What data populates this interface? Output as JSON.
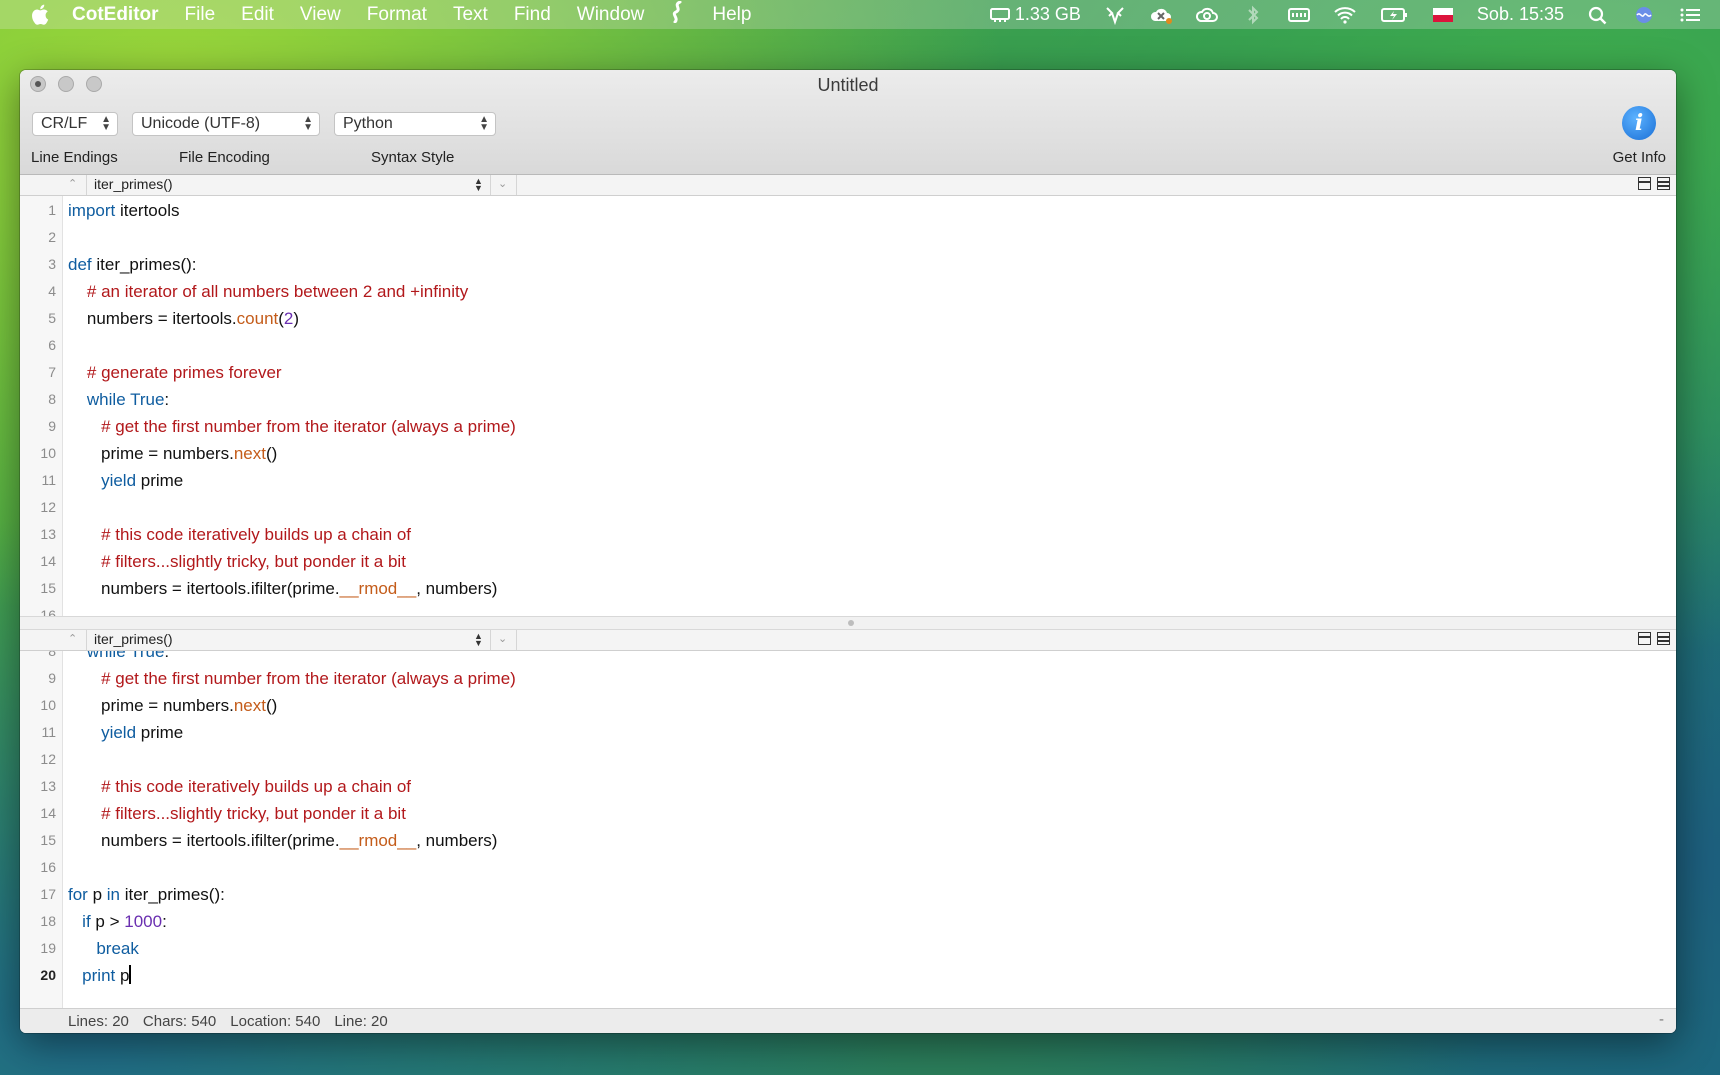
{
  "menubar": {
    "app_name": "CotEditor",
    "items": [
      "File",
      "Edit",
      "View",
      "Format",
      "Text",
      "Find",
      "Window",
      "Help"
    ],
    "memory": "1.33 GB",
    "clock": "Sob. 15:35"
  },
  "window": {
    "title": "Untitled",
    "line_endings_value": "CR/LF",
    "encoding_value": "Unicode (UTF-8)",
    "syntax_value": "Python",
    "line_endings_label": "Line Endings",
    "encoding_label": "File Encoding",
    "syntax_label": "Syntax Style",
    "get_info_label": "Get Info"
  },
  "navigator": {
    "function": "iter_primes()"
  },
  "code_lines": [
    [
      {
        "t": "import",
        "c": "kw"
      },
      {
        "t": " itertools",
        "c": ""
      }
    ],
    [],
    [
      {
        "t": "def",
        "c": "kw"
      },
      {
        "t": " iter_primes():",
        "c": ""
      }
    ],
    [
      {
        "t": "    ",
        "c": ""
      },
      {
        "t": "# an iterator of all numbers between 2 and +infinity",
        "c": "cm"
      }
    ],
    [
      {
        "t": "    numbers = itertools.",
        "c": ""
      },
      {
        "t": "count",
        "c": "fn"
      },
      {
        "t": "(",
        "c": ""
      },
      {
        "t": "2",
        "c": "nm"
      },
      {
        "t": ")",
        "c": ""
      }
    ],
    [],
    [
      {
        "t": "    ",
        "c": ""
      },
      {
        "t": "# generate primes forever",
        "c": "cm"
      }
    ],
    [
      {
        "t": "    ",
        "c": ""
      },
      {
        "t": "while",
        "c": "kw"
      },
      {
        "t": " ",
        "c": ""
      },
      {
        "t": "True",
        "c": "kw"
      },
      {
        "t": ":",
        "c": ""
      }
    ],
    [
      {
        "t": "       ",
        "c": ""
      },
      {
        "t": "# get the first number from the iterator (always a prime)",
        "c": "cm"
      }
    ],
    [
      {
        "t": "       prime = numbers.",
        "c": ""
      },
      {
        "t": "next",
        "c": "fn"
      },
      {
        "t": "()",
        "c": ""
      }
    ],
    [
      {
        "t": "       ",
        "c": ""
      },
      {
        "t": "yield",
        "c": "kw"
      },
      {
        "t": " prime",
        "c": ""
      }
    ],
    [],
    [
      {
        "t": "       ",
        "c": ""
      },
      {
        "t": "# this code iteratively builds up a chain of",
        "c": "cm"
      }
    ],
    [
      {
        "t": "       ",
        "c": ""
      },
      {
        "t": "# filters...slightly tricky, but ponder it a bit",
        "c": "cm"
      }
    ],
    [
      {
        "t": "       numbers = itertools.ifilter(prime.",
        "c": ""
      },
      {
        "t": "__rmod__",
        "c": "fn"
      },
      {
        "t": ", numbers)",
        "c": ""
      }
    ],
    [],
    [
      {
        "t": "for",
        "c": "kw"
      },
      {
        "t": " p ",
        "c": ""
      },
      {
        "t": "in",
        "c": "kw"
      },
      {
        "t": " iter_primes():",
        "c": ""
      }
    ],
    [
      {
        "t": "   ",
        "c": ""
      },
      {
        "t": "if",
        "c": "kw"
      },
      {
        "t": " p > ",
        "c": ""
      },
      {
        "t": "1000",
        "c": "nm"
      },
      {
        "t": ":",
        "c": ""
      }
    ],
    [
      {
        "t": "      ",
        "c": ""
      },
      {
        "t": "break",
        "c": "kw"
      }
    ],
    [
      {
        "t": "   ",
        "c": ""
      },
      {
        "t": "print",
        "c": "kw"
      },
      {
        "t": " p",
        "c": ""
      }
    ]
  ],
  "current_line": 20,
  "status": {
    "lines": "Lines: 20",
    "chars": "Chars: 540",
    "location": "Location: 540",
    "line": "Line: 20",
    "dash": "-"
  }
}
